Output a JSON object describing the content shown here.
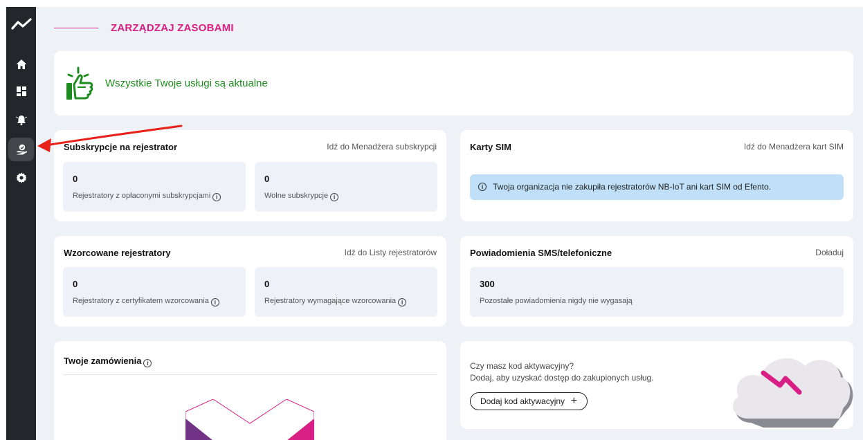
{
  "colors": {
    "accent": "#d71f85",
    "success": "#1e8b1e",
    "sidebar": "#24262b",
    "background": "#eef1f6"
  },
  "sidebar": {
    "items": [
      {
        "name": "home-icon",
        "active": false
      },
      {
        "name": "dashboard-icon",
        "active": false
      },
      {
        "name": "alarm-icon",
        "active": false
      },
      {
        "name": "resources-icon",
        "active": true
      },
      {
        "name": "gear-icon",
        "active": false
      }
    ]
  },
  "header": {
    "title": "ZARZĄDZAJ ZASOBAMI"
  },
  "banner": {
    "message": "Wszystkie Twoje usługi są aktualne",
    "icon": "thumbs-up-icon"
  },
  "subscriptions": {
    "title": "Subskrypcje na rejestrator",
    "link": "Idź do Menadżera subskrypcji",
    "stats": [
      {
        "value": "0",
        "label": "Rejestratory z opłaconymi subskrypcjami"
      },
      {
        "value": "0",
        "label": "Wolne subskrypcje"
      }
    ]
  },
  "sim": {
    "title": "Karty SIM",
    "link": "Idź do Menadżera kart SIM",
    "info": "Twoja organizacja nie zakupiła rejestratorów NB-IoT ani kart SIM od Efento."
  },
  "calibrated": {
    "title": "Wzorcowane rejestratory",
    "link": "Idź do Listy rejestratorów",
    "stats": [
      {
        "value": "0",
        "label": "Rejestratory z certyfikatem wzorcowania"
      },
      {
        "value": "0",
        "label": "Rejestratory wymagające wzorcowania"
      }
    ]
  },
  "notifications": {
    "title": "Powiadomienia SMS/telefoniczne",
    "link": "Doładuj",
    "stats": [
      {
        "value": "300",
        "label": "Pozostałe powiadomienia nigdy nie wygasają"
      }
    ]
  },
  "orders": {
    "title": "Twoje zamówienia"
  },
  "activation": {
    "question": "Czy masz kod aktywacyjny?",
    "description": "Dodaj, aby uzyskać dostęp do zakupionych usług.",
    "button_label": "Dodaj kod aktywacyjny",
    "button_icon": "plus-icon"
  },
  "info_glyph": "i"
}
